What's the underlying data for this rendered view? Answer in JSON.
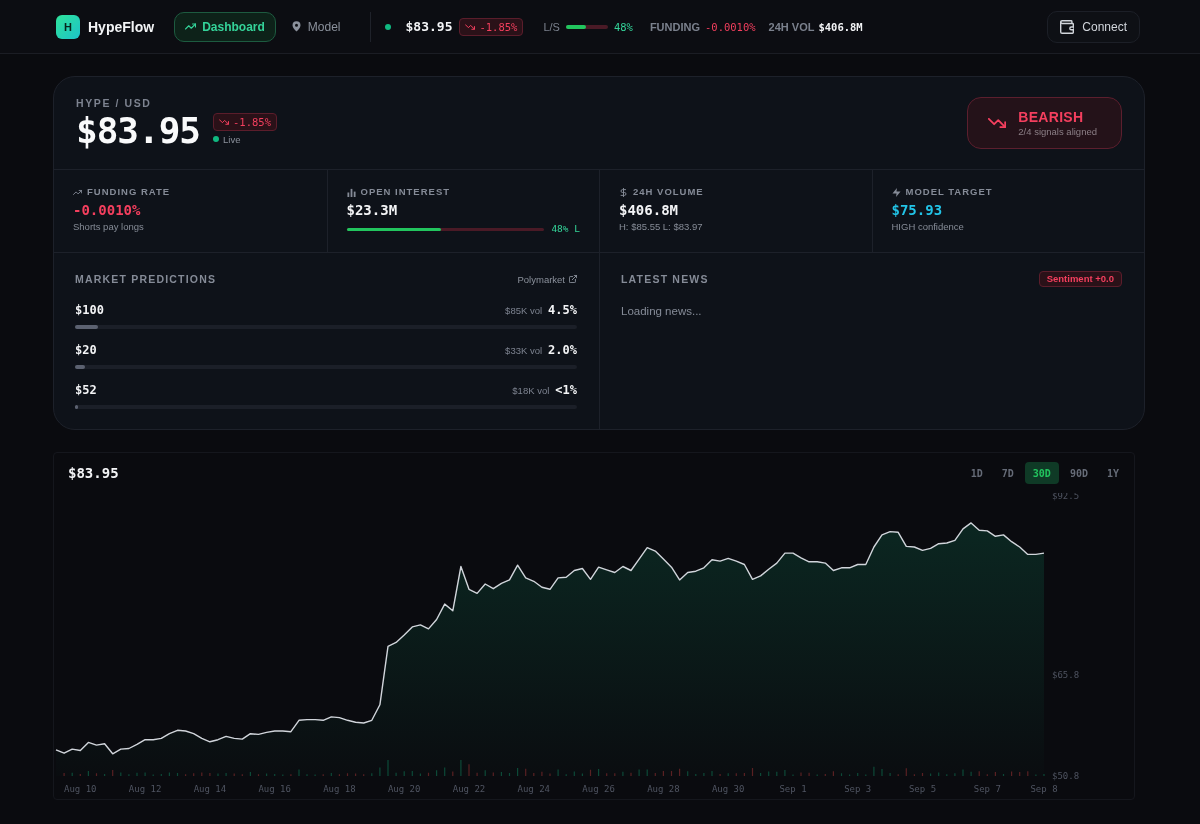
{
  "nav": {
    "brand": {
      "mark": "H",
      "name": "HypeFlow"
    },
    "tabs": [
      {
        "label": "Dashboard",
        "selected": true
      },
      {
        "label": "Model",
        "selected": false
      }
    ],
    "ticker": {
      "live": true,
      "price": "$83.95",
      "change": {
        "text": "-1.85%",
        "falling": true
      },
      "long_short": {
        "label": "L/S",
        "level": 0.48,
        "reading": "48%"
      },
      "funding": {
        "label": "FUNDING",
        "value": "-0.0010%",
        "negative": true
      },
      "volume": {
        "label": "24H VOL",
        "value": "$406.8M"
      }
    },
    "connect_button": "Connect"
  },
  "overview": {
    "pair": "HYPE / USD",
    "price": "$83.95",
    "change": {
      "text": "-1.85%",
      "falling": true
    },
    "status": {
      "live": true,
      "label": "Live"
    },
    "signal": {
      "falling": true,
      "label": "BEARISH",
      "detail": "2/4 signals aligned"
    },
    "stats": [
      {
        "label": "FUNDING RATE",
        "value": "-0.0010%",
        "color": "#f43f5e",
        "note": "Shorts pay longs"
      },
      {
        "label": "OPEN INTEREST",
        "value": "$23.3M",
        "color": "#f3f4f6",
        "long_ratio": {
          "level": 0.48,
          "reading": "48% L"
        }
      },
      {
        "label": "24H VOLUME",
        "value": "$406.8M",
        "color": "#f3f4f6",
        "note": "H: $85.55 L: $83.97"
      },
      {
        "label": "MODEL TARGET",
        "value": "$75.93",
        "color": "#22c3e6",
        "note": "HIGH confidence"
      }
    ],
    "predictions": {
      "title": "MARKET PREDICTIONS",
      "source": "Polymarket",
      "markets": [
        {
          "strike": "$100",
          "volume": "$85K vol",
          "probability": "4.5%",
          "level": 0.045
        },
        {
          "strike": "$20",
          "volume": "$33K vol",
          "probability": "2.0%",
          "level": 0.02
        },
        {
          "strike": "$52",
          "volume": "$18K vol",
          "probability": "<1%",
          "level": 0.005
        }
      ]
    },
    "news": {
      "title": "LATEST NEWS",
      "sentiment": {
        "text": "Sentiment +0.0",
        "negative": true
      },
      "status": "Loading news..."
    }
  },
  "chart": {
    "price": "$83.95",
    "timeframes": [
      {
        "label": "1D",
        "selected": false
      },
      {
        "label": "7D",
        "selected": false
      },
      {
        "label": "30D",
        "selected": true
      },
      {
        "label": "90D",
        "selected": false
      },
      {
        "label": "1Y",
        "selected": false
      }
    ],
    "chart_data": {
      "type": "area",
      "categories": [
        null,
        null,
        null,
        "Aug 10",
        null,
        null,
        null,
        null,
        null,
        null,
        null,
        "Aug 12",
        null,
        null,
        null,
        null,
        null,
        null,
        null,
        "Aug 14",
        null,
        null,
        null,
        null,
        null,
        null,
        null,
        "Aug 16",
        null,
        null,
        null,
        null,
        null,
        null,
        null,
        "Aug 18",
        null,
        null,
        null,
        null,
        null,
        null,
        null,
        "Aug 20",
        null,
        null,
        null,
        null,
        null,
        null,
        null,
        "Aug 22",
        null,
        null,
        null,
        null,
        null,
        null,
        null,
        "Aug 24",
        null,
        null,
        null,
        null,
        null,
        null,
        null,
        "Aug 26",
        null,
        null,
        null,
        null,
        null,
        null,
        null,
        "Aug 28",
        null,
        null,
        null,
        null,
        null,
        null,
        null,
        "Aug 30",
        null,
        null,
        null,
        null,
        null,
        null,
        null,
        "Sep 1",
        null,
        null,
        null,
        null,
        null,
        null,
        null,
        "Sep 3",
        null,
        null,
        null,
        null,
        null,
        null,
        null,
        "Sep 5",
        null,
        null,
        null,
        null,
        null,
        null,
        null,
        "Sep 7",
        null,
        null,
        null,
        null,
        null,
        null,
        "Sep 8"
      ],
      "series": [
        {
          "color": "#d1d5db",
          "values": [
            54.7,
            54.2,
            54.8,
            54.6,
            55.8,
            55.4,
            55.6,
            54.1,
            54.8,
            54.9,
            55.5,
            56.2,
            56.2,
            56.4,
            57.1,
            57.6,
            57.5,
            57.1,
            56.4,
            55.9,
            56.2,
            56.7,
            56.4,
            56.3,
            57.1,
            57.0,
            57.3,
            57.5,
            57.5,
            57.4,
            59.1,
            59.2,
            59.2,
            59.1,
            59.6,
            59.5,
            59.1,
            58.8,
            58.7,
            59.1,
            61.4,
            70.1,
            70.7,
            71.8,
            73.0,
            73.3,
            72.7,
            74.1,
            76.4,
            75.4,
            82.0,
            78.6,
            78.0,
            79.4,
            78.7,
            79.5,
            80.0,
            82.2,
            80.3,
            79.8,
            78.9,
            78.6,
            80.3,
            80.4,
            81.4,
            81.7,
            80.1,
            81.9,
            81.5,
            81.1,
            82.0,
            81.4,
            83.1,
            84.8,
            84.3,
            83.1,
            81.9,
            80.0,
            81.1,
            81.3,
            81.8,
            83.0,
            82.8,
            83.2,
            82.8,
            82.3,
            80.1,
            80.6,
            81.6,
            82.5,
            84.0,
            84.0,
            83.3,
            82.7,
            82.7,
            82.5,
            81.4,
            81.8,
            81.8,
            82.3,
            82.3,
            84.9,
            86.7,
            87.2,
            87.1,
            85.0,
            84.9,
            84.4,
            84.7,
            85.4,
            85.5,
            85.9,
            87.6,
            88.5,
            87.4,
            87.3,
            86.5,
            86.7,
            85.7,
            84.9,
            83.8,
            83.8,
            84.0
          ]
        }
      ],
      "ylim": [
        50.8,
        92.5
      ],
      "yticks": [
        {
          "value": 92.5,
          "label": "$92.5"
        },
        {
          "value": 65.8,
          "label": "$65.8"
        },
        {
          "value": 50.8,
          "label": "$50.8"
        }
      ]
    }
  }
}
